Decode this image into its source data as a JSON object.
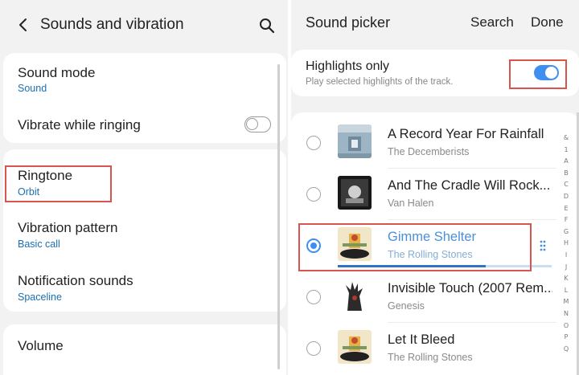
{
  "left": {
    "header": {
      "title": "Sounds and vibration"
    },
    "items": {
      "sound_mode": {
        "title": "Sound mode",
        "value": "Sound"
      },
      "vibrate_while_ringing": {
        "title": "Vibrate while ringing",
        "enabled": false
      },
      "ringtone": {
        "title": "Ringtone",
        "value": "Orbit"
      },
      "vibration_pattern": {
        "title": "Vibration pattern",
        "value": "Basic call"
      },
      "notification_sounds": {
        "title": "Notification sounds",
        "value": "Spaceline"
      },
      "volume": {
        "title": "Volume"
      }
    }
  },
  "right": {
    "header": {
      "title": "Sound picker",
      "search": "Search",
      "done": "Done"
    },
    "highlights": {
      "title": "Highlights only",
      "subtitle": "Play selected highlights of the track.",
      "enabled": true
    },
    "tracks": [
      {
        "title": "A Record Year For Rainfall",
        "artist": "The Decemberists",
        "selected": false
      },
      {
        "title": "And The Cradle Will Rock...",
        "artist": "Van Halen",
        "selected": false
      },
      {
        "title": "Gimme Shelter",
        "artist": "The Rolling Stones",
        "selected": true,
        "progress": 0.69
      },
      {
        "title": "Invisible Touch (2007 Rem...",
        "artist": "Genesis",
        "selected": false
      },
      {
        "title": "Let It Bleed",
        "artist": "The Rolling Stones",
        "selected": false
      }
    ],
    "index_letters": [
      "&",
      "1",
      "A",
      "B",
      "C",
      "D",
      "E",
      "F",
      "G",
      "H",
      "I",
      "J",
      "K",
      "L",
      "M",
      "N",
      "O",
      "P",
      "Q"
    ]
  },
  "colors": {
    "accent": "#3e8ff0",
    "highlight_box": "#d9534f",
    "sub_value": "#1a6fb3",
    "background": "#f2f2f2"
  }
}
